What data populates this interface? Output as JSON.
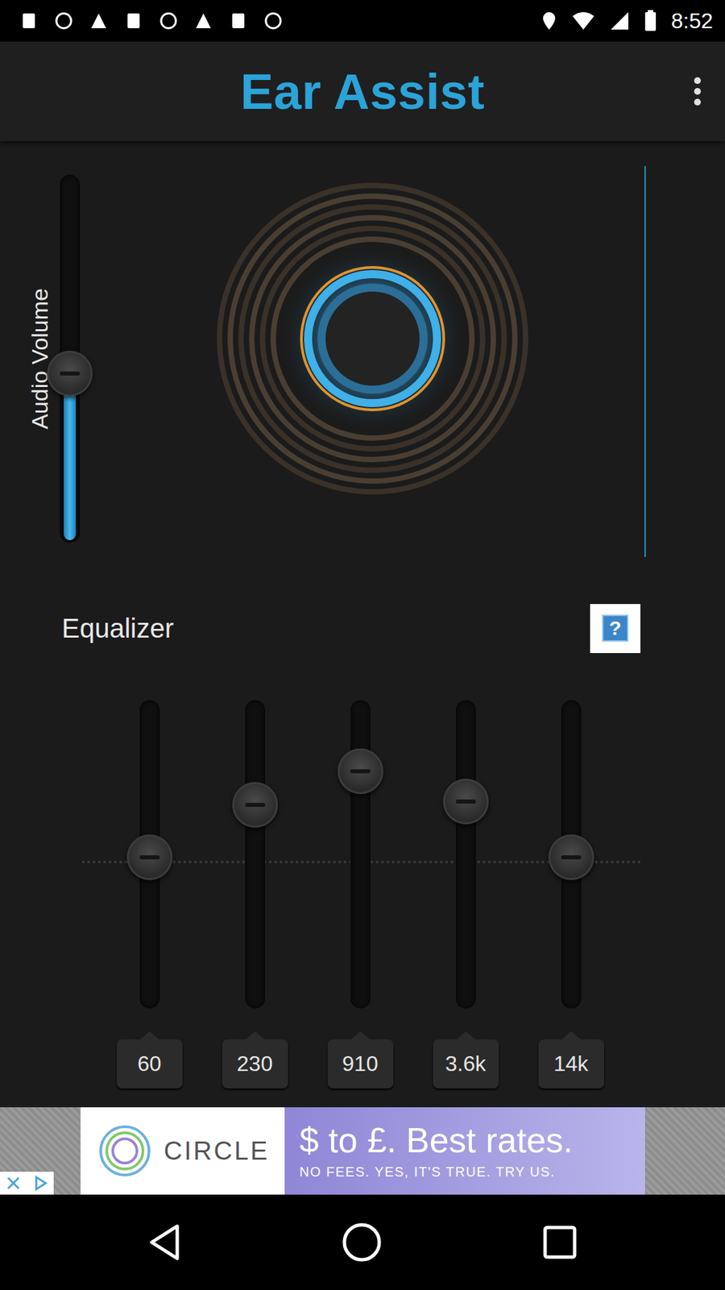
{
  "status_bar": {
    "time": "8:52"
  },
  "app_bar": {
    "title": "Ear Assist"
  },
  "volume": {
    "label": "Audio Volume",
    "level": 0.46
  },
  "equalizer": {
    "label": "Equalizer",
    "help": "?",
    "bands": [
      {
        "label": "60",
        "level": 0.49
      },
      {
        "label": "230",
        "level": 0.66
      },
      {
        "label": "910",
        "level": 0.77
      },
      {
        "label": "3.6k",
        "level": 0.67
      },
      {
        "label": "14k",
        "level": 0.49
      }
    ]
  },
  "ad": {
    "brand": "CIRCLE",
    "headline": "$ to £. Best rates.",
    "subline": "NO FEES. YES, IT'S TRUE. TRY US."
  }
}
